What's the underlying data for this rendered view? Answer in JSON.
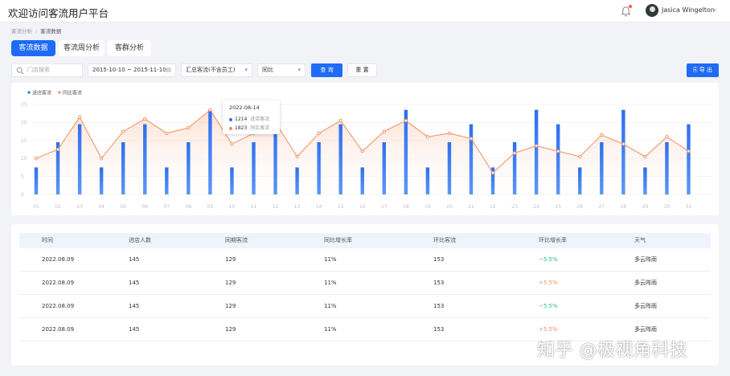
{
  "app": {
    "title": "欢迎访问客流用户平台"
  },
  "user": {
    "name": "Jasica Wingelton"
  },
  "breadcrumb": {
    "parent": "客流分析",
    "current": "客流数据"
  },
  "tabs": [
    {
      "label": "客流数据",
      "active": true
    },
    {
      "label": "客流周分析",
      "active": false
    },
    {
      "label": "客群分析",
      "active": false
    }
  ],
  "filters": {
    "search_placeholder": "门店搜索",
    "date_range": "2015-10-10 ~ 2015-11-10",
    "traffic_type": "汇总客流(不含员工)",
    "compare_mode": "同比",
    "query_label": "查 询",
    "reset_label": "重 置",
    "export_label": "导 出"
  },
  "colors": {
    "accent": "#1f6bf6",
    "bar": "#2e72e8",
    "line": "#f28c5e",
    "up": "#f28c5e",
    "down": "#2bbf7a"
  },
  "chart_data": {
    "type": "bar",
    "x": [
      "01",
      "02",
      "03",
      "04",
      "05",
      "06",
      "07",
      "08",
      "09",
      "10",
      "11",
      "12",
      "13",
      "14",
      "15",
      "16",
      "17",
      "18",
      "19",
      "20",
      "21",
      "22",
      "23",
      "24",
      "25",
      "26",
      "27",
      "28",
      "29",
      "30",
      "31"
    ],
    "ylim": [
      0,
      25
    ],
    "yticks": [
      "0",
      "5",
      "10",
      "15",
      "20",
      "25"
    ],
    "legend": "top-left",
    "series": [
      {
        "name": "进店客流",
        "type": "bar",
        "values": [
          7.5,
          14.5,
          19.5,
          7.5,
          14.5,
          19.5,
          7.5,
          14.5,
          23.5,
          7.5,
          14.5,
          19.5,
          7.5,
          14.5,
          19.5,
          7.5,
          14.5,
          23.5,
          7.5,
          14.5,
          19.5,
          7.5,
          14.5,
          23.5,
          19.5,
          7.5,
          14.5,
          23.5,
          7.5,
          14.5,
          19.5
        ]
      },
      {
        "name": "同比客流",
        "type": "line",
        "values": [
          10,
          12.5,
          21.5,
          10,
          17.5,
          21,
          17,
          18.5,
          23.5,
          14,
          17,
          20,
          10.5,
          17,
          20.5,
          12,
          17.5,
          20.5,
          16,
          17,
          15.5,
          6,
          11.5,
          13.5,
          12,
          10.5,
          16.5,
          14,
          10.5,
          16,
          12
        ]
      }
    ],
    "tooltip": {
      "date": "2022-08-14",
      "rows": [
        {
          "value": "1214",
          "label": "进店客流"
        },
        {
          "value": "1823",
          "label": "同比客流"
        }
      ]
    }
  },
  "table": {
    "columns": [
      "时间",
      "进店人数",
      "同期客流",
      "同比增长率",
      "环比客流",
      "环比增长率",
      "天气"
    ],
    "rows": [
      {
        "time": "2022.08.09",
        "visitors": "145",
        "same_period": "129",
        "yoy": "11%",
        "mom_traffic": "153",
        "mom_growth": "−5.5%",
        "trend": "down",
        "weather": "多云阵雨"
      },
      {
        "time": "2022.08.09",
        "visitors": "145",
        "same_period": "129",
        "yoy": "11%",
        "mom_traffic": "153",
        "mom_growth": "+5.5%",
        "trend": "up",
        "weather": "多云阵雨"
      },
      {
        "time": "2022.08.09",
        "visitors": "145",
        "same_period": "129",
        "yoy": "11%",
        "mom_traffic": "153",
        "mom_growth": "−5.5%",
        "trend": "down",
        "weather": "多云阵雨"
      },
      {
        "time": "2022.08.09",
        "visitors": "145",
        "same_period": "129",
        "yoy": "11%",
        "mom_traffic": "153",
        "mom_growth": "+5.5%",
        "trend": "up",
        "weather": "多云阵雨"
      }
    ]
  },
  "watermark": "知乎 @极视角科技"
}
